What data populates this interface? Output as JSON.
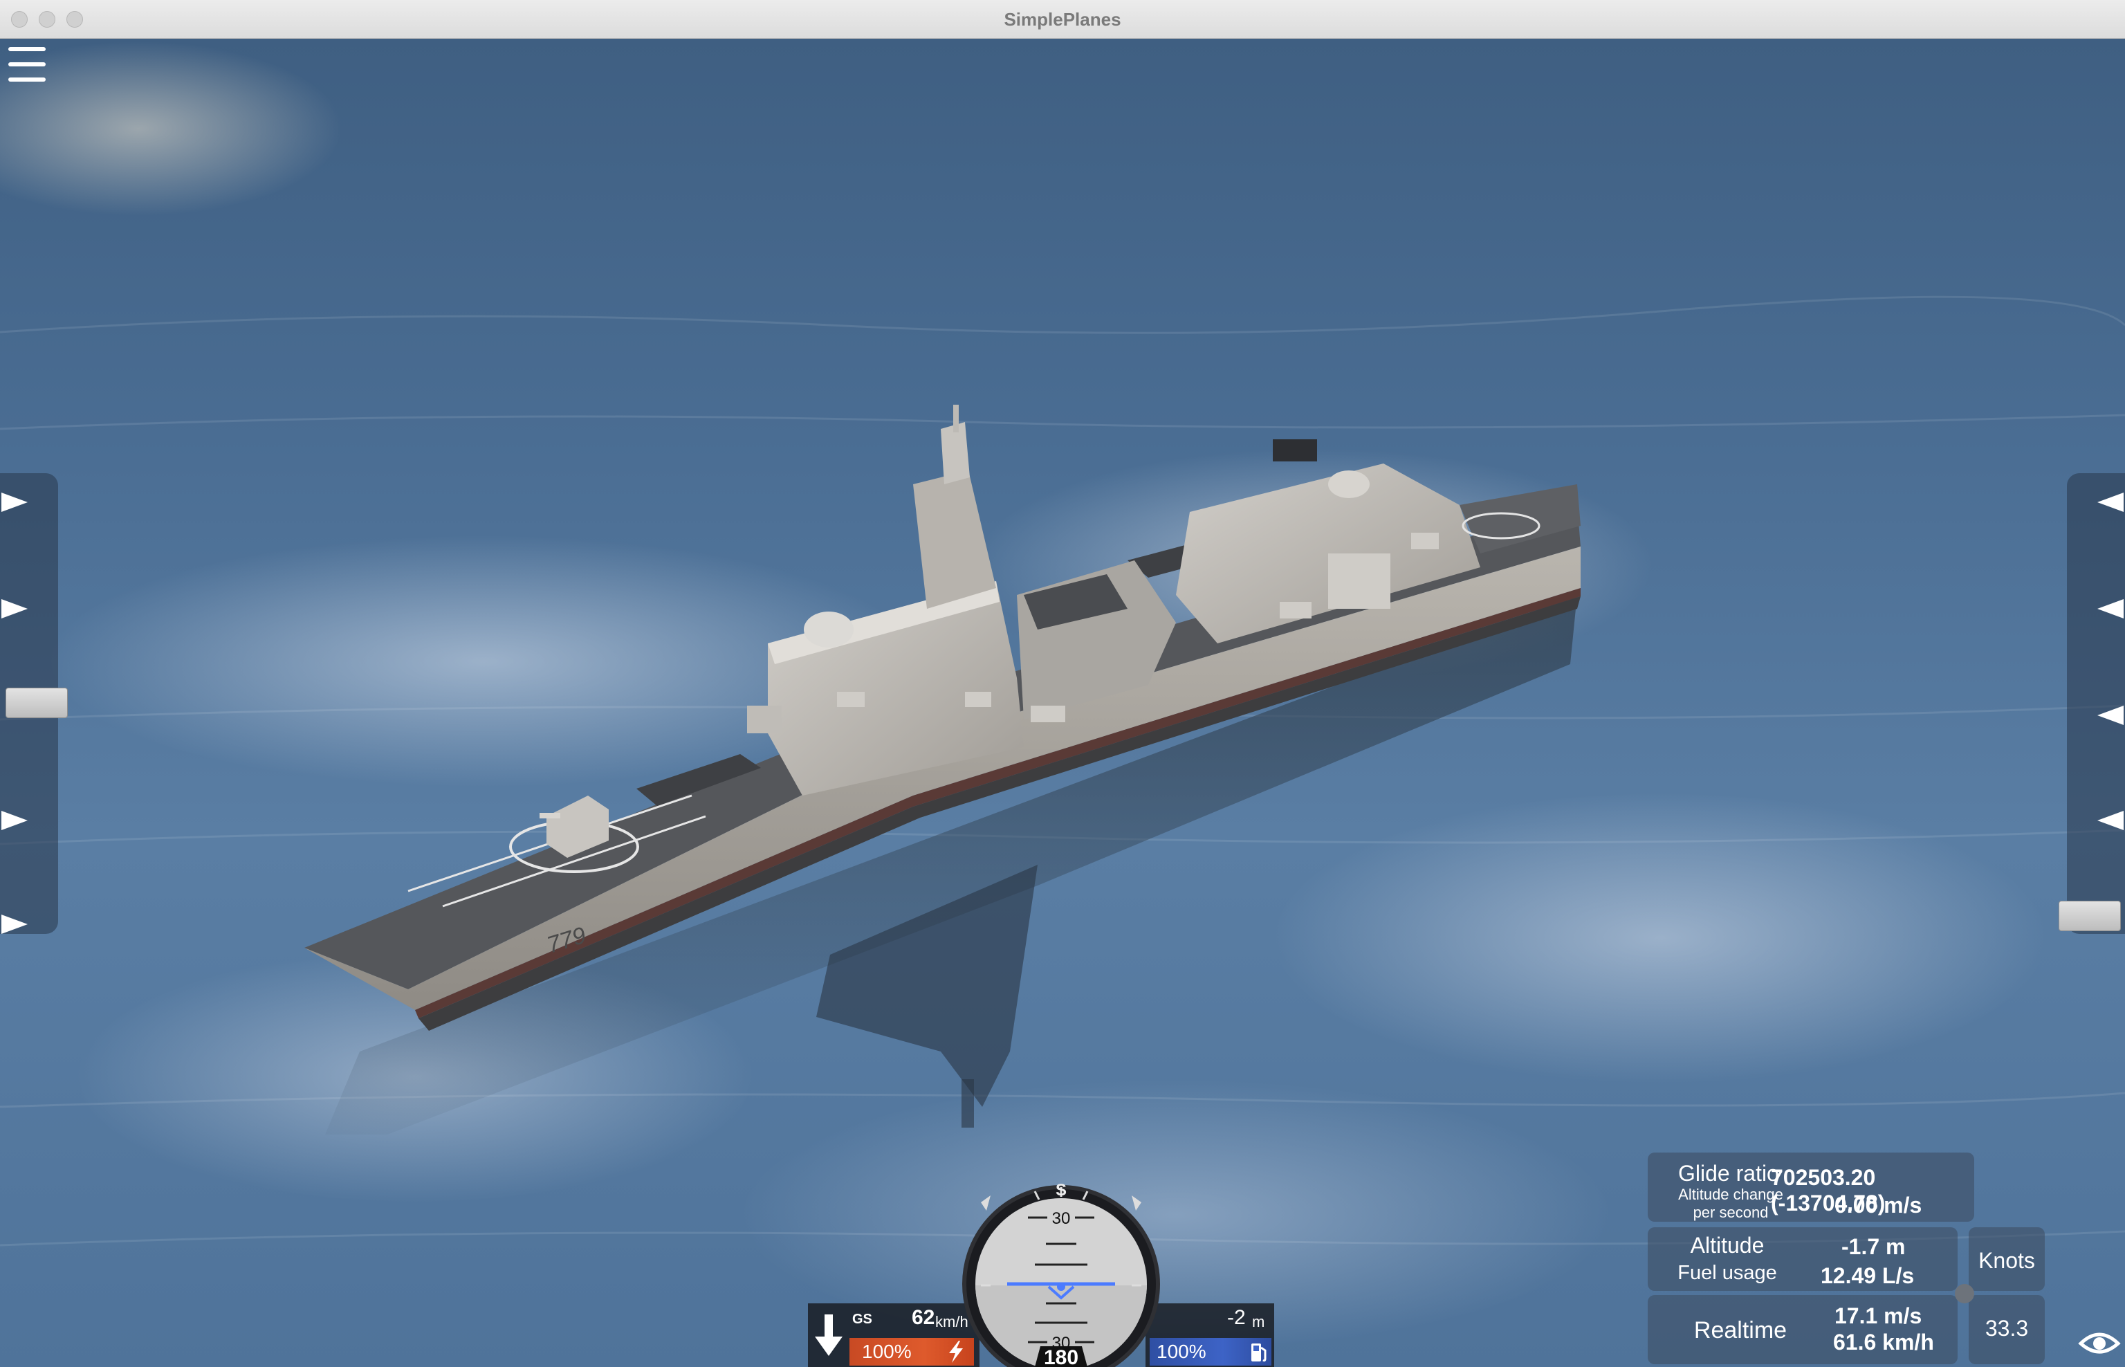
{
  "window": {
    "title": "SimplePlanes"
  },
  "ship": {
    "hull_number": "779"
  },
  "stats": {
    "glide_ratio_label": "Glide ratio",
    "glide_ratio_value": "702503.20 (-13704.78)",
    "altitude_change_label_line1": "Altitude change",
    "altitude_change_label_line2": "per second",
    "altitude_change_value": "0.00 m/s",
    "altitude_label": "Altitude",
    "altitude_value": "-1.7 m",
    "fuel_usage_label": "Fuel usage",
    "fuel_usage_value": "12.49 L/s",
    "realtime_label": "Realtime",
    "realtime_value_ms": "17.1 m/s",
    "realtime_value_kmh": "61.6 km/h",
    "knots_label": "Knots",
    "knots_value": "33.3"
  },
  "hud": {
    "gs_label": "GS",
    "ground_speed_value": "62",
    "ground_speed_unit": "km/h",
    "altitude_value": "-2",
    "altitude_unit": "m",
    "throttle_percent": "100%",
    "fuel_percent": "100%",
    "heading_value": "180",
    "heading_letter": "S",
    "pitch_ladder_top": "30",
    "pitch_ladder_bottom": "30",
    "throttle_level": 1.0,
    "fuel_level": 1.0
  },
  "colors": {
    "throttle_bar": "#de5a2c",
    "fuel_bar": "#3d63c6",
    "horizon_marker": "#4b7bff"
  },
  "icons": [
    "menu-icon",
    "down-arrow-icon",
    "lightning-icon",
    "fuel-pump-icon",
    "eye-icon"
  ]
}
